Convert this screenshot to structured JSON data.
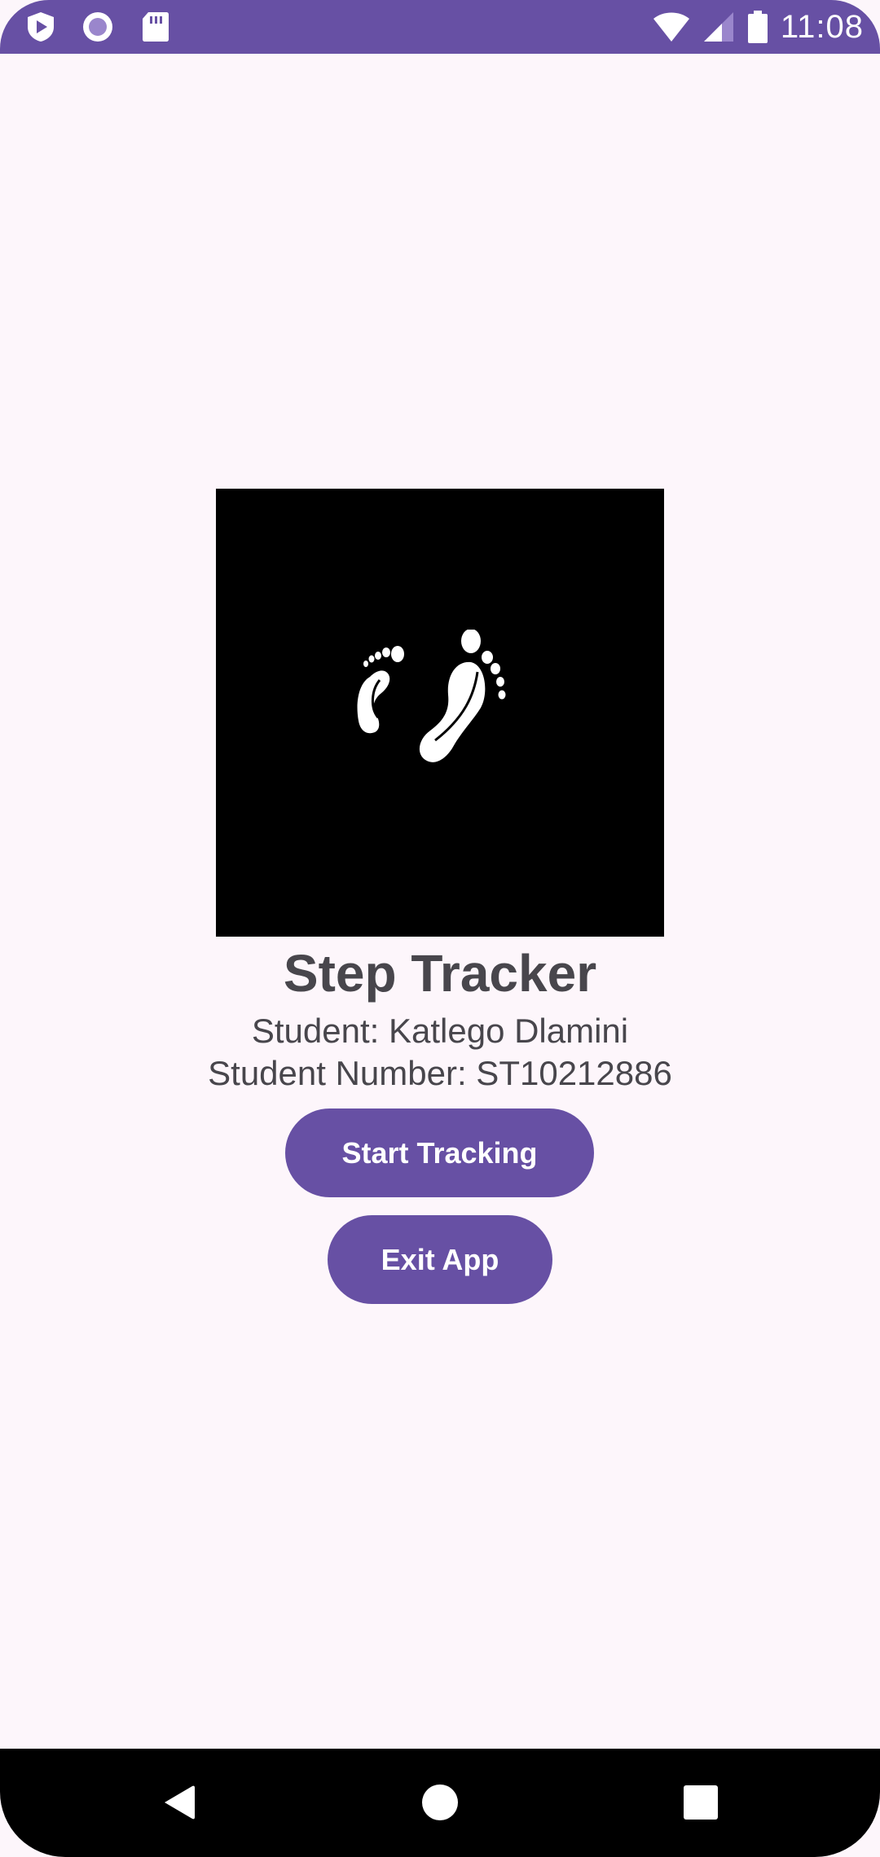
{
  "status_bar": {
    "time": "11:08",
    "left_icons": [
      "shield-play-icon",
      "radio-circle-icon",
      "sd-card-icon"
    ],
    "right_icons": [
      "wifi-icon",
      "cell-signal-icon",
      "battery-icon"
    ],
    "background_color": "#6750a4"
  },
  "main": {
    "logo_icon": "footprints-icon",
    "title": "Step Tracker",
    "student_name": "Student: Katlego Dlamini",
    "student_number": "Student Number: ST10212886",
    "start_button_label": "Start Tracking",
    "exit_button_label": "Exit App",
    "accent_color": "#6750a4",
    "text_color": "#48464c",
    "background_color": "#fdf6fb"
  },
  "nav_bar": {
    "back_icon": "back-triangle-icon",
    "home_icon": "home-circle-icon",
    "recents_icon": "recents-square-icon"
  }
}
